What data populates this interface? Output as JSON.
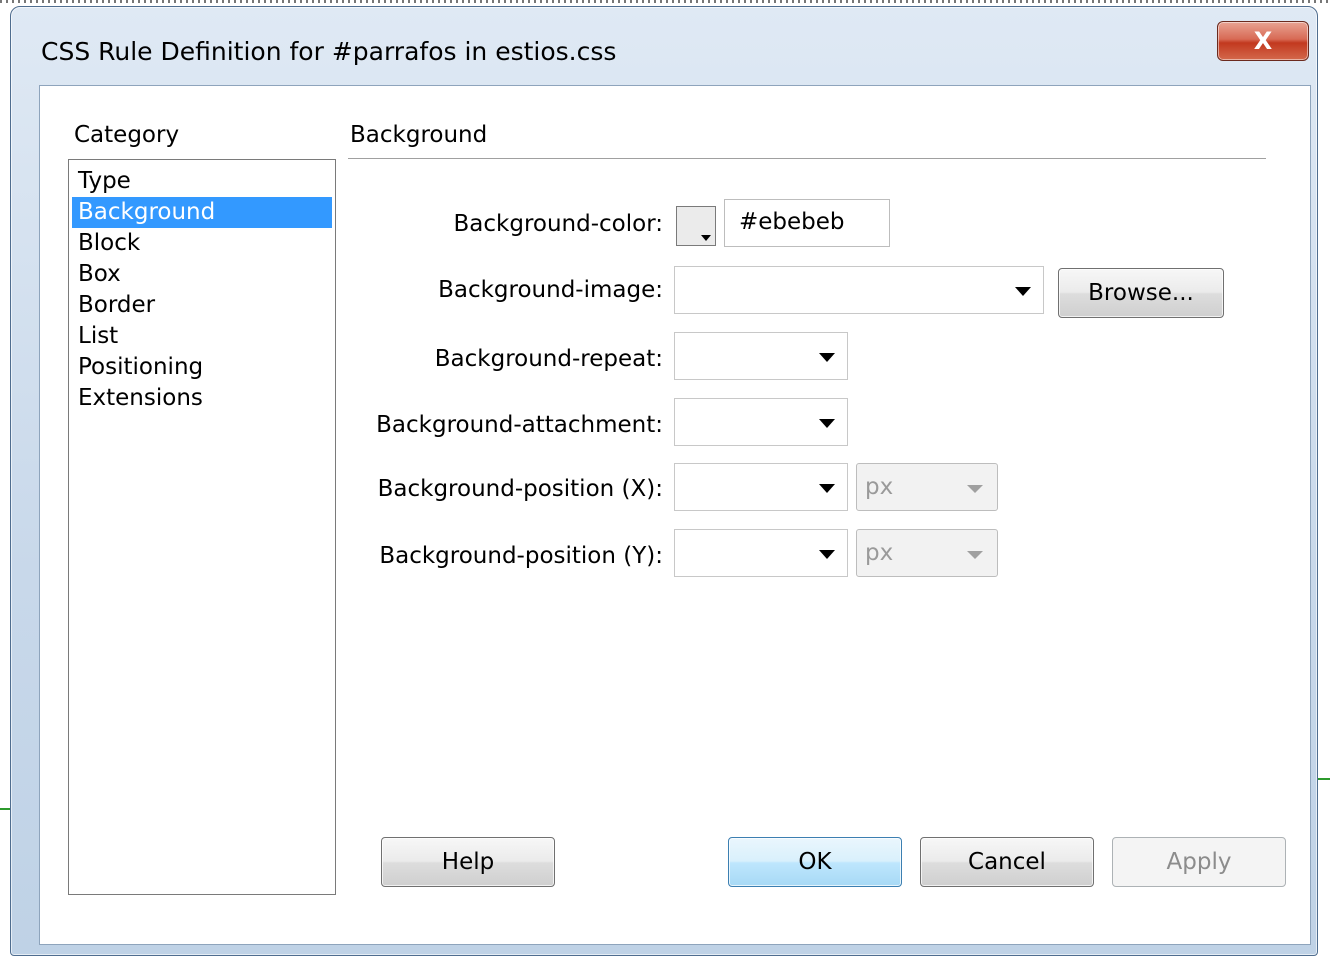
{
  "window": {
    "title": "CSS Rule Definition for #parrafos in estios.css",
    "close_glyph": "X"
  },
  "category": {
    "label": "Category",
    "items": [
      "Type",
      "Background",
      "Block",
      "Box",
      "Border",
      "List",
      "Positioning",
      "Extensions"
    ],
    "selected": "Background"
  },
  "panel": {
    "title": "Background",
    "fields": {
      "bg_color_label": "Background-color:",
      "bg_color_value": "#ebebeb",
      "bg_image_label": "Background-image:",
      "bg_image_value": "",
      "bg_repeat_label": "Background-repeat:",
      "bg_attachment_label": "Background-attachment:",
      "bg_pos_x_label": "Background-position (X):",
      "bg_pos_y_label": "Background-position (Y):",
      "unit_x": "px",
      "unit_y": "px"
    },
    "browse_label": "Browse..."
  },
  "buttons": {
    "help": "Help",
    "ok": "OK",
    "cancel": "Cancel",
    "apply": "Apply"
  },
  "colors": {
    "selection": "#3399ff",
    "swatch": "#ebebeb"
  }
}
